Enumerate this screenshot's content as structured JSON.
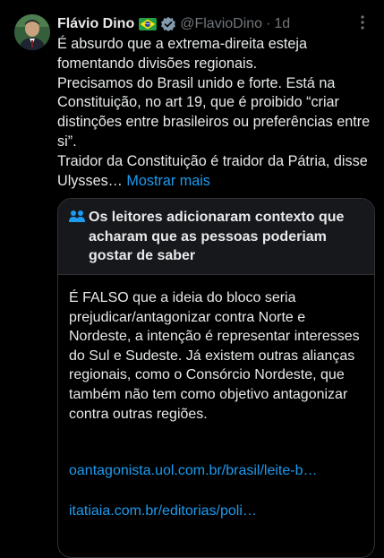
{
  "tweet": {
    "author_name": "Flávio Dino",
    "handle": "@FlavioDino",
    "separator": "·",
    "time": "1d",
    "text_lines": [
      "É absurdo que a extrema-direita esteja fomentando divisões regionais.",
      "Precisamos do Brasil unido e forte. Está na Constituição, no art 19, que é proibido “criar distinções entre brasileiros ou preferências entre si”.",
      "Traidor da Constituição é traidor da Pátria, disse Ulysses…"
    ],
    "show_more": "Mostrar mais"
  },
  "community_note": {
    "title": "Os leitores adicionaram contexto que acharam que as pessoas poderiam gostar de saber",
    "body": "É FALSO que a ideia do bloco seria prejudicar/antagonizar contra Norte e Nordeste, a intenção é representar interesses do Sul e Sudeste. Já existem outras alianças regionais, como o Consórcio Nordeste, que também não tem como objetivo antagonizar contra outras regiões.",
    "links": [
      "oantagonista.uol.com.br/brasil/leite-b…",
      "itatiaia.com.br/editorias/poli…"
    ]
  },
  "icons": {
    "flag": "brazil-flag-icon",
    "verified": "verified-badge-icon",
    "more": "more-options-icon",
    "note": "people-icon"
  },
  "colors": {
    "background": "#000000",
    "text": "#e7e9ea",
    "secondary_text": "#71767b",
    "link": "#1d9bf0",
    "border": "#2f3336",
    "note_header_bg": "#16181c"
  }
}
